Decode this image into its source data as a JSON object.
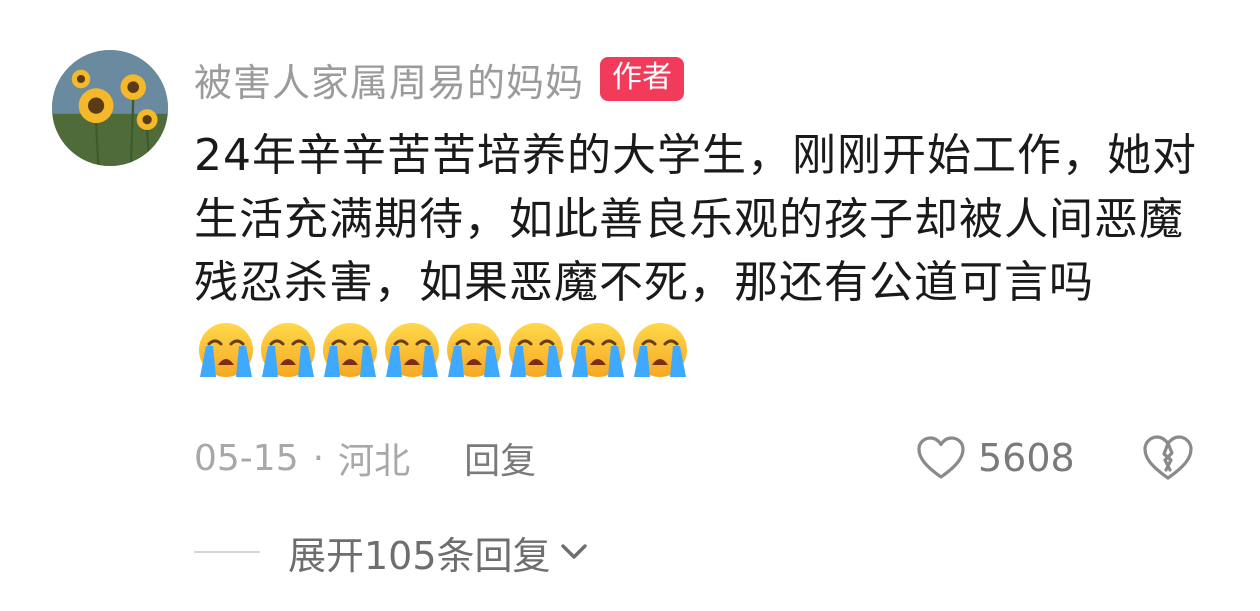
{
  "comment": {
    "username": "被害人家属周易的妈妈",
    "badge": "作者",
    "text": "24年辛辛苦苦培养的大学生，刚刚开始工作，她对生活充满期待，如此善良乐观的孩子却被人间恶魔残忍杀害，如果恶魔不死，那还有公道可言吗",
    "emoji_count": 8,
    "emoji_name": "loudly-crying-face",
    "date": "05-15",
    "separator": "·",
    "location": "河北",
    "reply_label": "回复",
    "like_count": "5608"
  },
  "expand": {
    "label": "展开105条回复"
  },
  "colors": {
    "badge_bg": "#f23a5a",
    "username": "#9b9b9b",
    "meta": "#a8a8a8",
    "text": "#1a1a1a"
  },
  "icons": {
    "like": "heart-outline-icon",
    "dislike": "broken-heart-icon",
    "expand": "chevron-down-icon"
  }
}
